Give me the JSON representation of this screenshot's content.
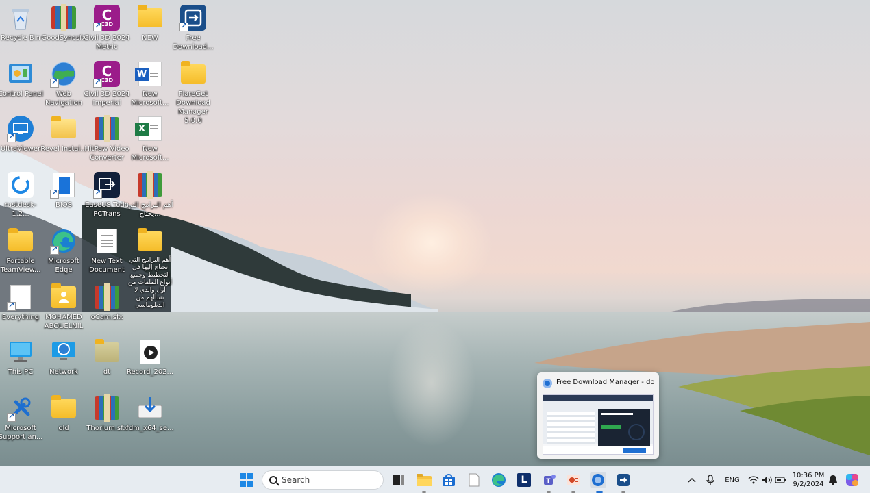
{
  "desktop": {
    "icons": [
      {
        "label": "Recycle Bin",
        "icon": "recycle-bin-icon"
      },
      {
        "label": "GoodSyncsfx",
        "icon": "archive-icon"
      },
      {
        "label": "Civil 3D 2024 Metric",
        "icon": "civil3d-icon"
      },
      {
        "label": "NEW",
        "icon": "folder-icon"
      },
      {
        "label": "Free Download...",
        "icon": "fdm-icon"
      },
      {
        "label": "Control Panel",
        "icon": "control-panel-icon"
      },
      {
        "label": "Web Navigation",
        "icon": "globe-icon"
      },
      {
        "label": "Civil 3D 2024 Imperial",
        "icon": "civil3d-icon"
      },
      {
        "label": "New Microsoft...",
        "icon": "word-icon"
      },
      {
        "label": "FlareGet Download Manager 5.0.0",
        "icon": "folder-icon"
      },
      {
        "label": "UltraViewer",
        "icon": "ultraviewer-icon"
      },
      {
        "label": "Revel Instal...",
        "icon": "folder-icon"
      },
      {
        "label": "HitPaw Video Converter",
        "icon": "archive-icon"
      },
      {
        "label": "New Microsoft...",
        "icon": "excel-icon"
      },
      {
        "label": "rustdesk-1.2...",
        "icon": "rustdesk-icon"
      },
      {
        "label": "BIOS",
        "icon": "bios-icon"
      },
      {
        "label": "EaseUS Todo PCTrans",
        "icon": "easeus-icon"
      },
      {
        "label": "أهم البرامج التي يحتاج...",
        "icon": "winrar-icon"
      },
      {
        "label": "Portable TeamView...",
        "icon": "folder-icon"
      },
      {
        "label": "Microsoft Edge",
        "icon": "edge-icon"
      },
      {
        "label": "New Text Document",
        "icon": "text-document-icon"
      },
      {
        "label": "أهم البرامج التي تحتاج إليها في التخطيط وجميع أنواع الملفات من أول والذي لا تسألهم من الدبلوماسي",
        "icon": "folder-icon"
      },
      {
        "label": "Everything",
        "icon": "document-icon"
      },
      {
        "label": "MOHAMED ABOUELNIL",
        "icon": "user-folder-icon"
      },
      {
        "label": "oCam.sfx",
        "icon": "archive-icon"
      },
      {
        "label": "This PC",
        "icon": "monitor-icon"
      },
      {
        "label": "Network",
        "icon": "network-icon"
      },
      {
        "label": "dt",
        "icon": "folder-icon"
      },
      {
        "label": "Record_202...",
        "icon": "media-file-icon"
      },
      {
        "label": "Microsoft Support an...",
        "icon": "tools-icon"
      },
      {
        "label": "old",
        "icon": "folder-icon"
      },
      {
        "label": "Thorium.sfx",
        "icon": "archive-icon"
      },
      {
        "label": "fdm_x64_se...",
        "icon": "installer-icon"
      }
    ]
  },
  "thumbnail": {
    "title": "Free Download Manager - dow..."
  },
  "taskbar": {
    "search_placeholder": "Search",
    "apps": [
      {
        "name": "start",
        "icon": "windows-start-icon"
      },
      {
        "name": "task-view",
        "icon": "task-view-icon"
      },
      {
        "name": "file-explorer",
        "icon": "file-explorer-icon"
      },
      {
        "name": "store",
        "icon": "store-icon"
      },
      {
        "name": "notepad",
        "icon": "document-icon"
      },
      {
        "name": "edge",
        "icon": "edge-icon"
      },
      {
        "name": "l-app",
        "icon": "l-app-icon"
      },
      {
        "name": "teams",
        "icon": "teams-icon"
      },
      {
        "name": "ppt-app",
        "icon": "presentation-icon"
      },
      {
        "name": "chrome-like",
        "icon": "browser-icon"
      },
      {
        "name": "fdm",
        "icon": "fdm-icon"
      }
    ],
    "tray": {
      "language": "ENG",
      "time": "10:36 PM",
      "date": "9/2/2024"
    }
  },
  "colors": {
    "taskbar_bg": "#e7ecf1",
    "accent": "#1f6fd1"
  }
}
